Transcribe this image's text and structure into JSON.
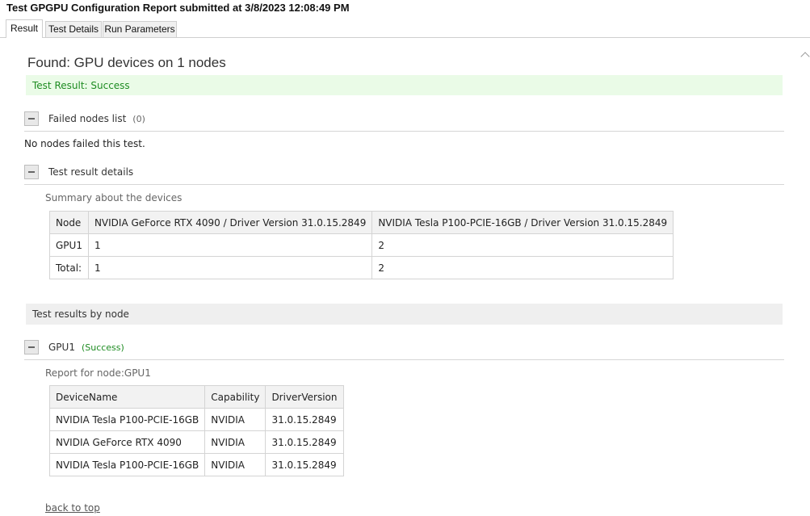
{
  "window": {
    "title": "Test GPGPU Configuration Report submitted at 3/8/2023 12:08:49 PM"
  },
  "tabs": [
    {
      "label": "Result"
    },
    {
      "label": "Test Details"
    },
    {
      "label": "Run Parameters"
    }
  ],
  "report": {
    "found_title": "Found: GPU devices on 1 nodes",
    "test_result": "Test Result: Success",
    "failed_nodes": {
      "label": "Failed nodes list",
      "count": "(0)",
      "message": "No nodes failed this test."
    },
    "details": {
      "label": "Test result details",
      "summary_caption": "Summary about the devices",
      "columns": [
        "Node",
        "NVIDIA GeForce RTX 4090 / Driver Version 31.0.15.2849",
        "NVIDIA Tesla P100-PCIE-16GB / Driver Version 31.0.15.2849"
      ],
      "rows": [
        [
          "GPU1",
          "1",
          "2"
        ],
        [
          "Total:",
          "1",
          "2"
        ]
      ]
    },
    "by_node": {
      "band_label": "Test results by node",
      "node_label": "GPU1",
      "node_status": "(Success)",
      "report_caption": "Report for node:GPU1",
      "columns": [
        "DeviceName",
        "Capability",
        "DriverVersion"
      ],
      "rows": [
        [
          "NVIDIA Tesla P100-PCIE-16GB",
          "NVIDIA",
          "31.0.15.2849"
        ],
        [
          "NVIDIA GeForce RTX 4090",
          "NVIDIA",
          "31.0.15.2849"
        ],
        [
          "NVIDIA Tesla P100-PCIE-16GB",
          "NVIDIA",
          "31.0.15.2849"
        ]
      ]
    },
    "back_to_top": "back to top"
  },
  "colors": {
    "success_text": "#1e8c22",
    "success_bg": "#eafbe7",
    "band_bg": "#efefef"
  }
}
